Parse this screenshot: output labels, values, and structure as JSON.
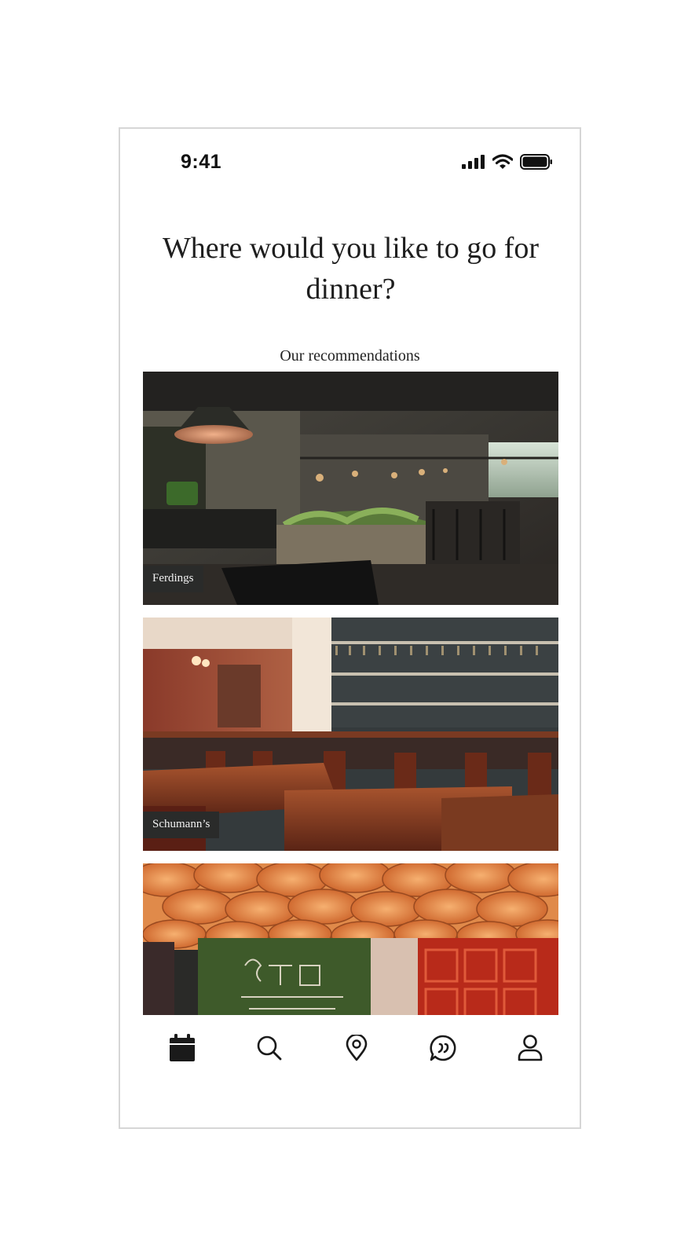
{
  "status_bar": {
    "time": "9:41"
  },
  "headline": "Where would you like to go for dinner?",
  "section_label": "Our recommendations",
  "restaurants": [
    {
      "name": "Ferdings"
    },
    {
      "name": "Schumann’s"
    },
    {
      "name": ""
    }
  ],
  "tab_bar": {
    "items": [
      {
        "icon": "calendar-icon",
        "active": true
      },
      {
        "icon": "search-icon",
        "active": false
      },
      {
        "icon": "location-pin-icon",
        "active": false
      },
      {
        "icon": "chat-quote-icon",
        "active": false
      },
      {
        "icon": "profile-icon",
        "active": false
      }
    ]
  },
  "colors": {
    "label_bg": "#2a2b2a",
    "icon": "#1a1a1a",
    "frame": "#d6d6d6"
  }
}
